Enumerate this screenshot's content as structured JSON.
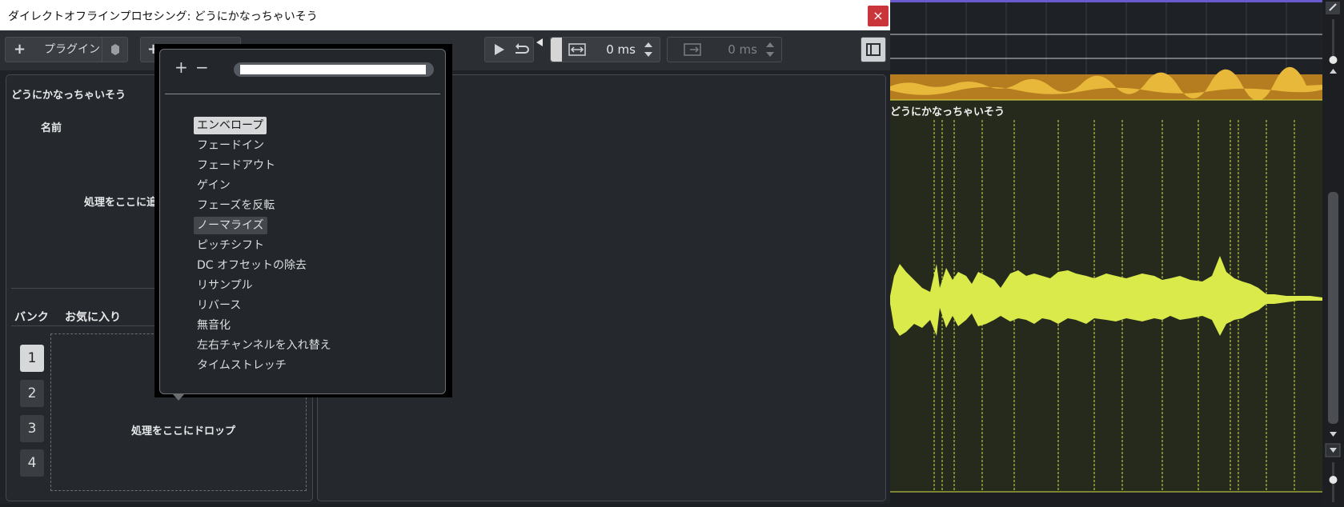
{
  "dialog": {
    "title": "ダイレクトオフラインプロセシング: どうにかなっちゃいそう",
    "close_glyph": "×"
  },
  "toolbar": {
    "plugin_label": "プラグイン",
    "add_glyph": "+",
    "time_value_1": "0 ms",
    "time_value_2": "0 ms"
  },
  "left_panel": {
    "clip_name": "どうにかなっちゃいそう",
    "name_label": "名前",
    "add_process_hint": "処理をここに追",
    "bank_label": "バンク",
    "favorites_label": "お気に入り",
    "banks": [
      "1",
      "2",
      "3",
      "4"
    ],
    "drop_hint": "処理をここにドロップ"
  },
  "popup": {
    "plus": "+",
    "minus": "−",
    "search_value": "",
    "items": [
      "エンベロープ",
      "フェードイン",
      "フェードアウト",
      "ゲイン",
      "フェーズを反転",
      "ノーマライズ",
      "ピッチシフト",
      "DC オフセットの除去",
      "リサンプル",
      "リバース",
      "無音化",
      "左右チャンネルを入れ替え",
      "タイムストレッチ"
    ],
    "selected_index": 0,
    "hover_index": 5
  },
  "timeline": {
    "event_name": "どうにかなっちゃいそう",
    "waveform_color": "#d9ea4a",
    "overview_color": "#e0a92c",
    "marker_color": "#d8e24a"
  },
  "colors": {
    "close": "#c9353a",
    "accent_top": "#6a5acd"
  }
}
